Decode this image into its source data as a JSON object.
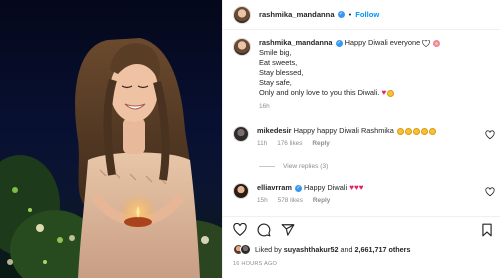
{
  "post": {
    "username": "rashmika_mandanna",
    "follow_label": "Follow",
    "separator": "•",
    "caption": {
      "username": "rashmika_mandanna",
      "first_line": "Happy Diwali everyone",
      "lines": [
        "Smile big,",
        "Eat sweets,",
        "Stay blessed,",
        "Stay safe,",
        "Only and only love to you this Diwali."
      ],
      "timestamp": "16h"
    },
    "comments": [
      {
        "username": "mikedesir",
        "text": "Happy happy Diwali Rashmika",
        "time": "11h",
        "likes": "176 likes",
        "reply": "Reply"
      },
      {
        "username": "elliavrram",
        "text": "Happy Diwali",
        "time": "15h",
        "likes": "578 likes",
        "reply": "Reply"
      }
    ],
    "view_replies": "View replies (3)",
    "likes": {
      "prefix": "Liked by",
      "user": "suyashthakur52",
      "joiner": "and",
      "others": "2,661,717 others"
    },
    "age": "16 HOURS AGO"
  },
  "icons": [
    "heart-icon",
    "comment-icon",
    "share-icon",
    "bookmark-icon",
    "more-icon",
    "verified-icon"
  ],
  "colors": {
    "follow": "#0095f6",
    "muted": "#8e8e8e",
    "verified": "#3897f0"
  }
}
